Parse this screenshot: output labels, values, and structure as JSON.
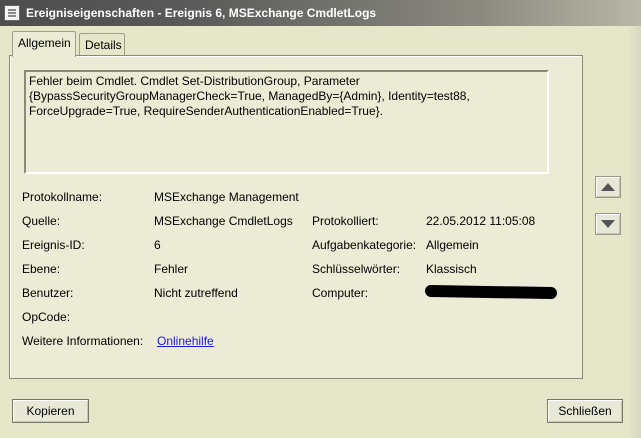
{
  "window": {
    "title": "Ereigniseigenschaften - Ereignis 6, MSExchange CmdletLogs"
  },
  "tabs": [
    {
      "label": "Allgemein",
      "active": true
    },
    {
      "label": "Details",
      "active": false
    }
  ],
  "description": {
    "lines": [
      "Fehler beim Cmdlet. Cmdlet Set-DistributionGroup, Parameter",
      "{BypassSecurityGroupManagerCheck=True, ManagedBy={Admin}, Identity=test88,",
      "ForceUpgrade=True, RequireSenderAuthenticationEnabled=True}."
    ]
  },
  "fields": {
    "protokollname": {
      "label": "Protokollname:",
      "value": "MSExchange Management"
    },
    "quelle": {
      "label": "Quelle:",
      "value": "MSExchange CmdletLogs"
    },
    "protokolliert": {
      "label": "Protokolliert:",
      "value": "22.05.2012 11:05:08"
    },
    "ereignis_id": {
      "label": "Ereignis-ID:",
      "value": "6"
    },
    "aufgabenkategorie": {
      "label": "Aufgabenkategorie:",
      "value": "Allgemein"
    },
    "ebene": {
      "label": "Ebene:",
      "value": "Fehler"
    },
    "schluesselwoerter": {
      "label": "Schlüsselwörter:",
      "value": "Klassisch"
    },
    "benutzer": {
      "label": "Benutzer:",
      "value": "Nicht zutreffend"
    },
    "computer": {
      "label": "Computer:",
      "value": ""
    },
    "opcode": {
      "label": "OpCode:",
      "value": ""
    },
    "weitere": {
      "label": "Weitere Informationen:",
      "link": "Onlinehilfe"
    }
  },
  "buttons": {
    "copy": "Kopieren",
    "close": "Schließen"
  },
  "icons": {
    "nav_up": "arrow-up-icon",
    "nav_down": "arrow-down-icon"
  }
}
